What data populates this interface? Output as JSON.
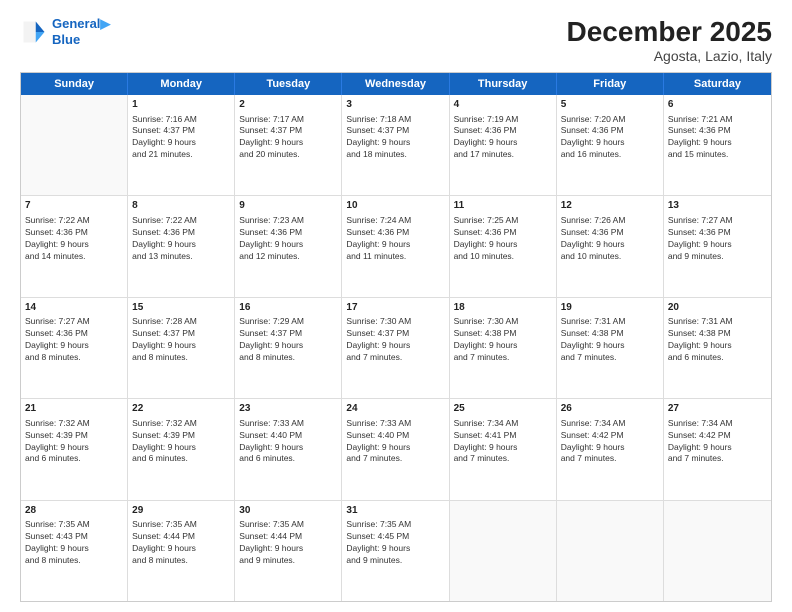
{
  "header": {
    "logo_line1": "General",
    "logo_line2": "Blue",
    "title": "December 2025",
    "subtitle": "Agosta, Lazio, Italy"
  },
  "days_of_week": [
    "Sunday",
    "Monday",
    "Tuesday",
    "Wednesday",
    "Thursday",
    "Friday",
    "Saturday"
  ],
  "weeks": [
    [
      {
        "day": "",
        "info": "",
        "empty": true
      },
      {
        "day": "1",
        "info": "Sunrise: 7:16 AM\nSunset: 4:37 PM\nDaylight: 9 hours\nand 21 minutes.",
        "empty": false
      },
      {
        "day": "2",
        "info": "Sunrise: 7:17 AM\nSunset: 4:37 PM\nDaylight: 9 hours\nand 20 minutes.",
        "empty": false
      },
      {
        "day": "3",
        "info": "Sunrise: 7:18 AM\nSunset: 4:37 PM\nDaylight: 9 hours\nand 18 minutes.",
        "empty": false
      },
      {
        "day": "4",
        "info": "Sunrise: 7:19 AM\nSunset: 4:36 PM\nDaylight: 9 hours\nand 17 minutes.",
        "empty": false
      },
      {
        "day": "5",
        "info": "Sunrise: 7:20 AM\nSunset: 4:36 PM\nDaylight: 9 hours\nand 16 minutes.",
        "empty": false
      },
      {
        "day": "6",
        "info": "Sunrise: 7:21 AM\nSunset: 4:36 PM\nDaylight: 9 hours\nand 15 minutes.",
        "empty": false
      }
    ],
    [
      {
        "day": "7",
        "info": "Sunrise: 7:22 AM\nSunset: 4:36 PM\nDaylight: 9 hours\nand 14 minutes.",
        "empty": false
      },
      {
        "day": "8",
        "info": "Sunrise: 7:22 AM\nSunset: 4:36 PM\nDaylight: 9 hours\nand 13 minutes.",
        "empty": false
      },
      {
        "day": "9",
        "info": "Sunrise: 7:23 AM\nSunset: 4:36 PM\nDaylight: 9 hours\nand 12 minutes.",
        "empty": false
      },
      {
        "day": "10",
        "info": "Sunrise: 7:24 AM\nSunset: 4:36 PM\nDaylight: 9 hours\nand 11 minutes.",
        "empty": false
      },
      {
        "day": "11",
        "info": "Sunrise: 7:25 AM\nSunset: 4:36 PM\nDaylight: 9 hours\nand 10 minutes.",
        "empty": false
      },
      {
        "day": "12",
        "info": "Sunrise: 7:26 AM\nSunset: 4:36 PM\nDaylight: 9 hours\nand 10 minutes.",
        "empty": false
      },
      {
        "day": "13",
        "info": "Sunrise: 7:27 AM\nSunset: 4:36 PM\nDaylight: 9 hours\nand 9 minutes.",
        "empty": false
      }
    ],
    [
      {
        "day": "14",
        "info": "Sunrise: 7:27 AM\nSunset: 4:36 PM\nDaylight: 9 hours\nand 8 minutes.",
        "empty": false
      },
      {
        "day": "15",
        "info": "Sunrise: 7:28 AM\nSunset: 4:37 PM\nDaylight: 9 hours\nand 8 minutes.",
        "empty": false
      },
      {
        "day": "16",
        "info": "Sunrise: 7:29 AM\nSunset: 4:37 PM\nDaylight: 9 hours\nand 8 minutes.",
        "empty": false
      },
      {
        "day": "17",
        "info": "Sunrise: 7:30 AM\nSunset: 4:37 PM\nDaylight: 9 hours\nand 7 minutes.",
        "empty": false
      },
      {
        "day": "18",
        "info": "Sunrise: 7:30 AM\nSunset: 4:38 PM\nDaylight: 9 hours\nand 7 minutes.",
        "empty": false
      },
      {
        "day": "19",
        "info": "Sunrise: 7:31 AM\nSunset: 4:38 PM\nDaylight: 9 hours\nand 7 minutes.",
        "empty": false
      },
      {
        "day": "20",
        "info": "Sunrise: 7:31 AM\nSunset: 4:38 PM\nDaylight: 9 hours\nand 6 minutes.",
        "empty": false
      }
    ],
    [
      {
        "day": "21",
        "info": "Sunrise: 7:32 AM\nSunset: 4:39 PM\nDaylight: 9 hours\nand 6 minutes.",
        "empty": false
      },
      {
        "day": "22",
        "info": "Sunrise: 7:32 AM\nSunset: 4:39 PM\nDaylight: 9 hours\nand 6 minutes.",
        "empty": false
      },
      {
        "day": "23",
        "info": "Sunrise: 7:33 AM\nSunset: 4:40 PM\nDaylight: 9 hours\nand 6 minutes.",
        "empty": false
      },
      {
        "day": "24",
        "info": "Sunrise: 7:33 AM\nSunset: 4:40 PM\nDaylight: 9 hours\nand 7 minutes.",
        "empty": false
      },
      {
        "day": "25",
        "info": "Sunrise: 7:34 AM\nSunset: 4:41 PM\nDaylight: 9 hours\nand 7 minutes.",
        "empty": false
      },
      {
        "day": "26",
        "info": "Sunrise: 7:34 AM\nSunset: 4:42 PM\nDaylight: 9 hours\nand 7 minutes.",
        "empty": false
      },
      {
        "day": "27",
        "info": "Sunrise: 7:34 AM\nSunset: 4:42 PM\nDaylight: 9 hours\nand 7 minutes.",
        "empty": false
      }
    ],
    [
      {
        "day": "28",
        "info": "Sunrise: 7:35 AM\nSunset: 4:43 PM\nDaylight: 9 hours\nand 8 minutes.",
        "empty": false
      },
      {
        "day": "29",
        "info": "Sunrise: 7:35 AM\nSunset: 4:44 PM\nDaylight: 9 hours\nand 8 minutes.",
        "empty": false
      },
      {
        "day": "30",
        "info": "Sunrise: 7:35 AM\nSunset: 4:44 PM\nDaylight: 9 hours\nand 9 minutes.",
        "empty": false
      },
      {
        "day": "31",
        "info": "Sunrise: 7:35 AM\nSunset: 4:45 PM\nDaylight: 9 hours\nand 9 minutes.",
        "empty": false
      },
      {
        "day": "",
        "info": "",
        "empty": true
      },
      {
        "day": "",
        "info": "",
        "empty": true
      },
      {
        "day": "",
        "info": "",
        "empty": true
      }
    ]
  ]
}
